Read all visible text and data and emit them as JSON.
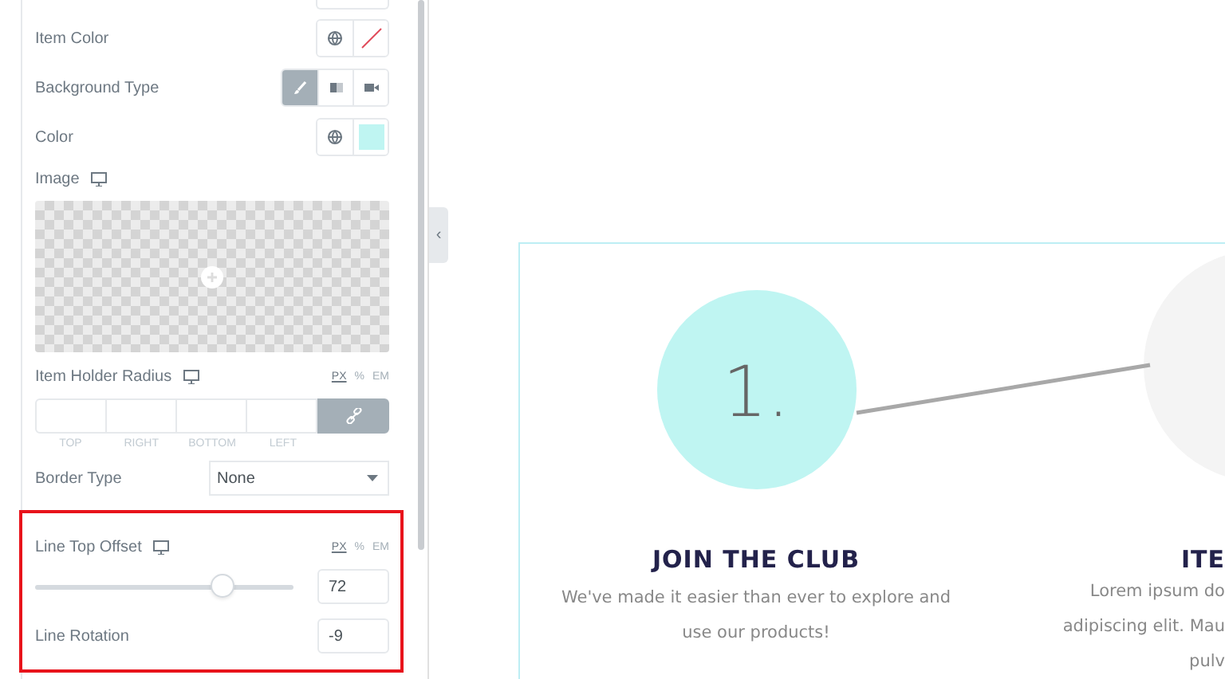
{
  "panel": {
    "rows": [
      {
        "kind": "color",
        "label": "Item Color",
        "empty": true
      },
      {
        "kind": "choose",
        "label": "Background Type",
        "options": [
          {
            "selected": true
          },
          {
            "selected": false
          },
          {
            "selected": false
          }
        ]
      },
      {
        "kind": "color",
        "label": "Color",
        "empty": false,
        "color": "#bff5f2"
      },
      {
        "kind": "image",
        "label": "Image",
        "responsive": true
      },
      {
        "kind": "dimensions",
        "label": "Item Holder Radius",
        "responsive": true,
        "units": [
          {
            "label": "PX",
            "selected": true
          },
          {
            "label": "%",
            "selected": false
          },
          {
            "label": "EM",
            "selected": false
          }
        ],
        "sides": [
          "TOP",
          "RIGHT",
          "BOTTOM",
          "LEFT"
        ],
        "linked": true
      },
      {
        "kind": "select",
        "label": "Border Type",
        "value": "None"
      }
    ],
    "highlight": [
      {
        "kind": "slider",
        "label": "Line Top Offset",
        "responsive": true,
        "units": [
          {
            "label": "PX",
            "selected": true
          },
          {
            "label": "%",
            "selected": false
          },
          {
            "label": "EM",
            "selected": false
          }
        ],
        "level": 0.72,
        "value": "72"
      },
      {
        "kind": "number",
        "label": "Line Rotation",
        "value": "-9"
      }
    ]
  },
  "collapse": {
    "glyph": "‹"
  },
  "steps": [
    {
      "number": "1.",
      "title": "JOIN THE CLUB",
      "lines": [
        "We've made it easier than ever to explore and",
        "use our products!"
      ]
    },
    {
      "title": "ITE",
      "lines": [
        "Lorem ipsum do",
        "adipiscing elit. Mau",
        "pulv"
      ]
    }
  ]
}
